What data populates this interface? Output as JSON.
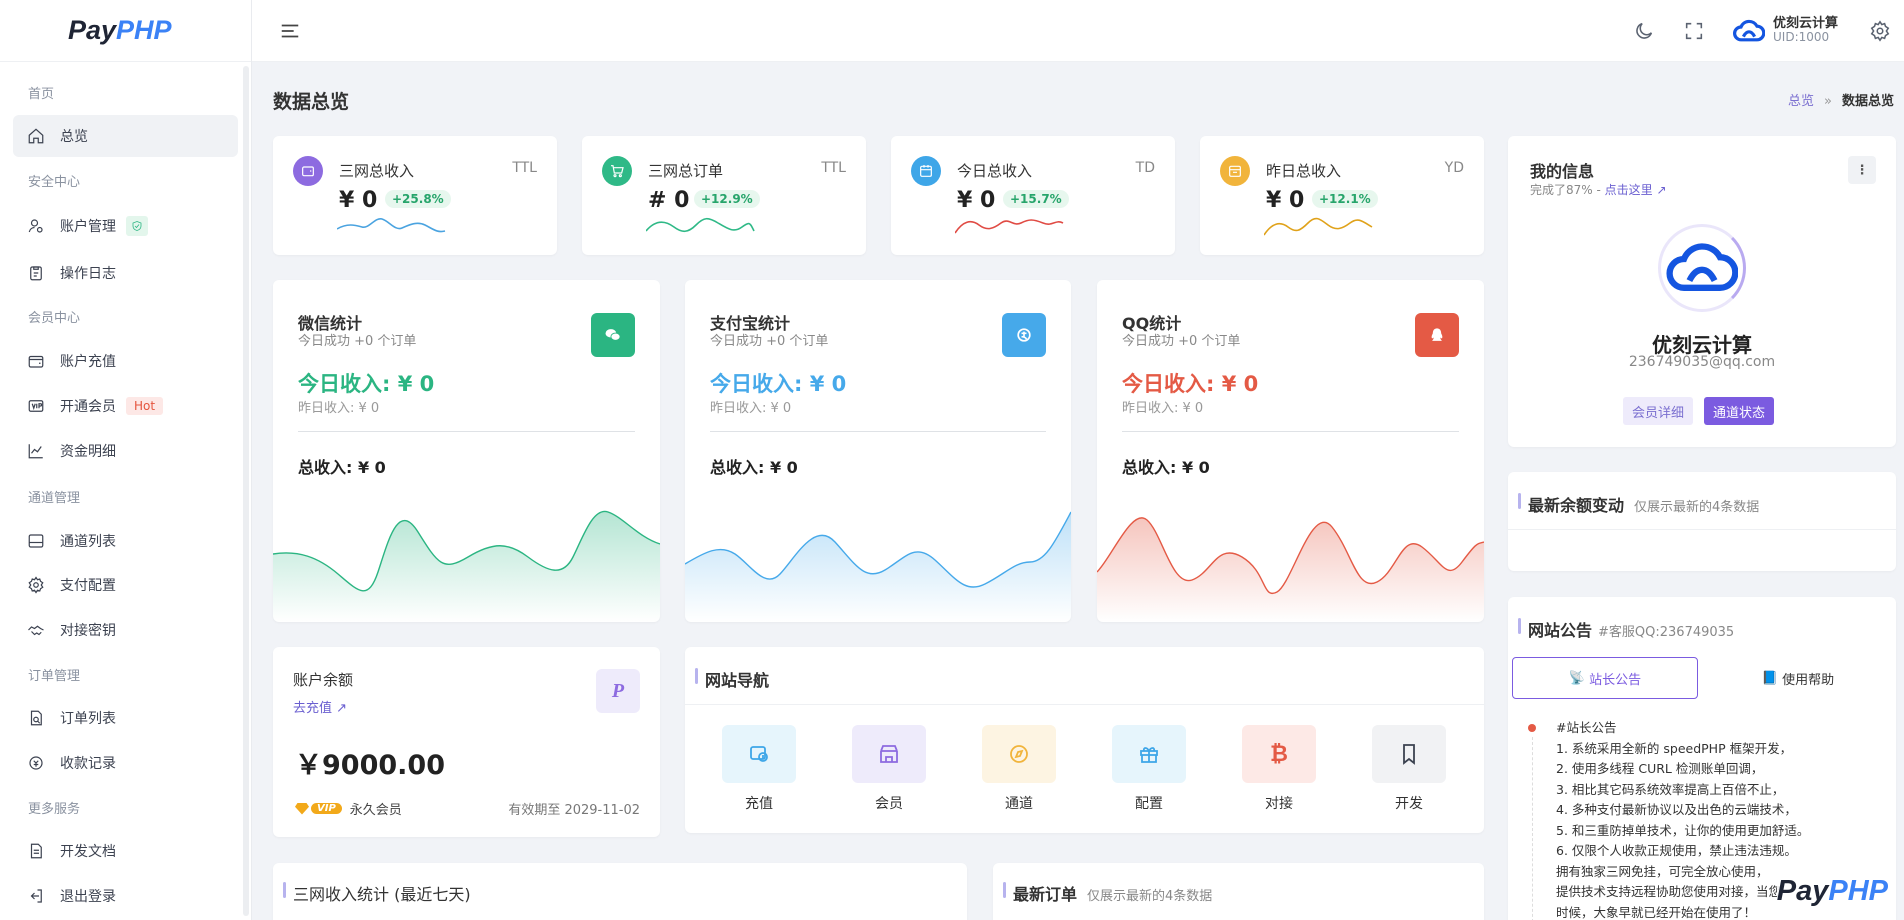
{
  "logo": {
    "pay": "Pay",
    "php": "PHP"
  },
  "sidebar": {
    "sections": [
      "首页",
      "安全中心",
      "会员中心",
      "通道管理",
      "订单管理",
      "更多服务"
    ],
    "items": [
      "总览",
      "账户管理",
      "操作日志",
      "账户充值",
      "开通会员",
      "资金明细",
      "通道列表",
      "支付配置",
      "对接密钥",
      "订单列表",
      "收款记录",
      "开发文档",
      "退出登录"
    ],
    "hot_badge": "Hot"
  },
  "topbar": {
    "user_name": "优刻云计算",
    "uid": "UID:1000"
  },
  "page": {
    "title": "数据总览",
    "breadcrumb": [
      "总览",
      "数据总览"
    ]
  },
  "stats": [
    {
      "label": "三网总收入",
      "tag": "TTL",
      "value": "¥ 0",
      "change": "+25.8%",
      "color": "#8d6be0",
      "spark": "#4aa3e0"
    },
    {
      "label": "三网总订单",
      "tag": "TTL",
      "value": "# 0",
      "change": "+12.9%",
      "color": "#2fb987",
      "spark": "#2fb987"
    },
    {
      "label": "今日总收入",
      "tag": "TD",
      "value": "¥ 0",
      "change": "+15.7%",
      "color": "#3ea6e8",
      "spark": "#e04b44"
    },
    {
      "label": "昨日总收入",
      "tag": "YD",
      "value": "¥ 0",
      "change": "+12.1%",
      "color": "#f1b43b",
      "spark": "#e0a21a"
    }
  ],
  "channels": [
    {
      "title": "微信统计",
      "sub": "今日成功 +0 个订单",
      "today": "今日收入: ¥ 0",
      "yesterday": "昨日收入: ¥ 0",
      "total": "总收入: ¥ 0",
      "color": "#2bb582"
    },
    {
      "title": "支付宝统计",
      "sub": "今日成功 +0 个订单",
      "today": "今日收入: ¥ 0",
      "yesterday": "昨日收入: ¥ 0",
      "total": "总收入: ¥ 0",
      "color": "#46a9ea"
    },
    {
      "title": "QQ统计",
      "sub": "今日成功 +0 个订单",
      "today": "今日收入: ¥ 0",
      "yesterday": "昨日收入: ¥ 0",
      "total": "总收入: ¥ 0",
      "color": "#e45a45"
    }
  ],
  "balance": {
    "title": "账户余额",
    "recharge": "去充值",
    "amount": "￥9000.00",
    "vip_badge": "VIP",
    "level": "永久会员",
    "expire": "有效期至 2029-11-02"
  },
  "site_nav": {
    "title": "网站导航",
    "items": [
      {
        "label": "充值",
        "icon": "recharge-icon",
        "bg": "#e6f5fc",
        "color": "#3ea6e8"
      },
      {
        "label": "会员",
        "icon": "store-icon",
        "bg": "#eeebfb",
        "color": "#8d6be0"
      },
      {
        "label": "通道",
        "icon": "compass-icon",
        "bg": "#fdf4e2",
        "color": "#f1b43b"
      },
      {
        "label": "配置",
        "icon": "gift-icon",
        "bg": "#e6f5fc",
        "color": "#3ea6e8"
      },
      {
        "label": "对接",
        "icon": "bitcoin-icon",
        "bg": "#fde9e6",
        "color": "#e45a45"
      },
      {
        "label": "开发",
        "icon": "bookmark-icon",
        "bg": "#f1f2f4",
        "color": "#3c4250"
      }
    ]
  },
  "bottom": {
    "income_title": "三网收入统计 (最近七天)",
    "orders_title": "最新订单",
    "orders_note": "仅展示最新的4条数据"
  },
  "profile": {
    "title": "我的信息",
    "progress": "完成了87% -",
    "progress_link": "点击这里",
    "name": "优刻云计算",
    "email": "236749035@qq.com",
    "btn_detail": "会员详细",
    "btn_channel": "通道状态"
  },
  "balance_changes": {
    "title": "最新余额变动",
    "note": "仅展示最新的4条数据"
  },
  "notice": {
    "title": "网站公告",
    "qq": "#客服QQ:236749035",
    "tab_owner": "站长公告",
    "tab_help": "使用帮助",
    "heading": "#站长公告",
    "lines": [
      "1. 系统采用全新的 speedPHP 框架开发，",
      "2. 使用多线程 CURL 检测账单回调，",
      "3. 相比其它码系统效率提高上百倍不止，",
      "4. 多种支付最新协议以及出色的云端技术，",
      "5. 和三重防掉单技术，让你的使用更加舒适。",
      "6. 仅限个人收款正规使用，禁止违法违规。",
      "拥有独家三网免挂，可完全放心使用，",
      "提供技术支持远程协助您使用对接，当您",
      "时候，大象早就已经开始在使用了！"
    ]
  }
}
